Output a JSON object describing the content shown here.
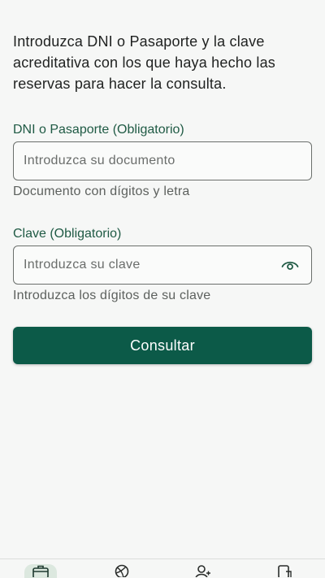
{
  "intro": {
    "text": "Introduzca DNI o Pasaporte y la clave acreditativa con los que haya hecho las reservas para hacer la consulta."
  },
  "document_field": {
    "label": "DNI o Pasaporte (Obligatorio)",
    "placeholder": "Introduzca su documento",
    "value": "",
    "helper": "Documento con dígitos y letra"
  },
  "password_field": {
    "label": "Clave (Obligatorio)",
    "placeholder": "Introduzca su clave",
    "value": "",
    "helper": "Introduzca los dígitos de su clave",
    "toggle_icon": "eye-icon"
  },
  "submit": {
    "label": "Consultar"
  },
  "bottom_nav": {
    "items": [
      {
        "icon": "briefcase-icon",
        "active": true
      },
      {
        "icon": "ball-icon",
        "active": false
      },
      {
        "icon": "user-icon",
        "active": false
      },
      {
        "icon": "document-icon",
        "active": false
      }
    ]
  },
  "colors": {
    "primary": "#0c5a48",
    "label": "#1f5a44",
    "background": "#f6f7f6"
  }
}
